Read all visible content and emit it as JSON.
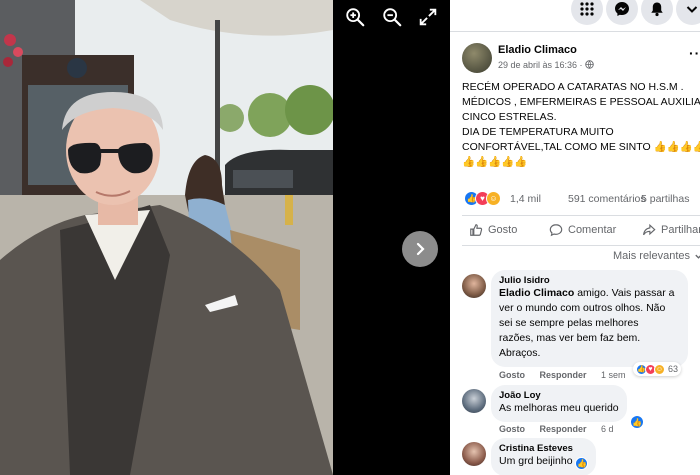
{
  "viewer": {
    "zoom_in_icon": "magnifier-plus-icon",
    "zoom_out_icon": "magnifier-minus-icon",
    "fullscreen_icon": "expand-arrows-icon",
    "next_icon": "chevron-right-icon"
  },
  "topbar": {
    "buttons": [
      "grid-menu-icon",
      "messenger-icon",
      "bell-icon",
      "chevron-down-icon"
    ]
  },
  "post": {
    "author": "Eladio Climaco",
    "date": "29 de abril às 16:36 ·",
    "privacy_icon": "globe-icon",
    "lines": [
      "RECÉM OPERADO A CATARATAS NO H.S.M .",
      "MÉDICOS , EMFERMEIRAS E PESSOAL AUXILIAR",
      "CINCO ESTRELAS.",
      "DIA DE TEMPERATURA MUITO",
      "CONFORTÁVEL,TAL COMO ME SINTO 👍👍👍👍",
      "👍👍👍👍👍"
    ],
    "reaction_count": "1,4 mil",
    "comments_count": "591 comentários",
    "shares_count": "5 partilhas"
  },
  "actions": {
    "like": "Gosto",
    "comment": "Comentar",
    "share": "Partilhar"
  },
  "relevance_label": "Mais relevantes",
  "comments": [
    {
      "name": "Julio Isidro",
      "tag": "Eladio Climaco",
      "lines": [
        " amigo. Vais passar a",
        "ver o mundo com outros olhos. Não",
        "sei se sempre pelas melhores",
        "razões, mas ver bem faz bem.",
        "Abraços."
      ],
      "like": "Gosto",
      "reply": "Responder",
      "time": "1 sem",
      "reactions": "63"
    },
    {
      "name": "João Loy",
      "text": "As melhoras meu querido",
      "like": "Gosto",
      "reply": "Responder",
      "time": "6 d"
    },
    {
      "name": "Cristina Esteves",
      "text": "Um grd beijinho"
    }
  ],
  "colors": {
    "like_blue": "#1877f2",
    "love_red": "#f33e58",
    "care_yellow": "#f7b125",
    "bubble_gray": "#f0f2f5",
    "meta_gray": "#65676b"
  }
}
